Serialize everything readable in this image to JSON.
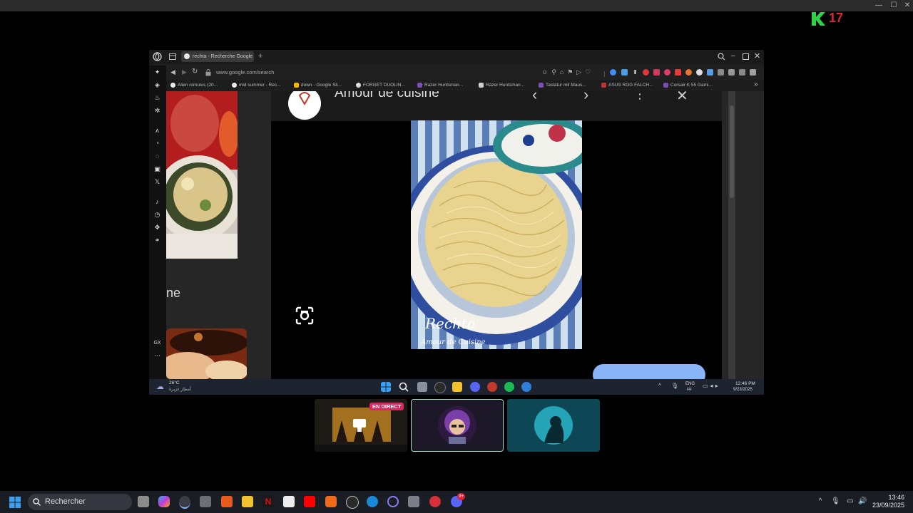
{
  "outer_window": {
    "brand_number": "17",
    "controls": {
      "minimize": "—",
      "maximize": "☐",
      "close": "✕"
    }
  },
  "browser": {
    "tab_title": "rechta - Recherche Google",
    "url": "www.google.com/search",
    "bookmarks": [
      "Alien romulus (20...",
      "mid summer - Rec...",
      "down - Google Sli...",
      "FORGET DUOLIN...",
      "Razer Huntsman...",
      "Razer Huntsman...",
      "Tastatur mit Maus...",
      "ASUS ROG FALCH...",
      "Corsair K 55 Gami..."
    ]
  },
  "image_viewer": {
    "source_name": "Amour de cuisine",
    "side_text": "ne",
    "image_caption": "Rechta",
    "image_caption_sub": "Amour de Cuisine"
  },
  "inner_taskbar": {
    "temperature": "26°C",
    "weather": "أمطار غزيرة",
    "language": "ENG",
    "language_sub": "FR",
    "time": "12:46 PM",
    "date": "9/23/2025"
  },
  "participants": {
    "live_label": "EN DIRECT"
  },
  "taskbar": {
    "search_placeholder": "Rechercher",
    "time": "13:46",
    "date": "23/09/2025",
    "discord_badge": "9+"
  },
  "colors": {
    "accent_blue": "#8ab4f8",
    "live_red": "#e0245e",
    "brand_green": "#2fd14a",
    "brand_red": "#e0243a"
  }
}
